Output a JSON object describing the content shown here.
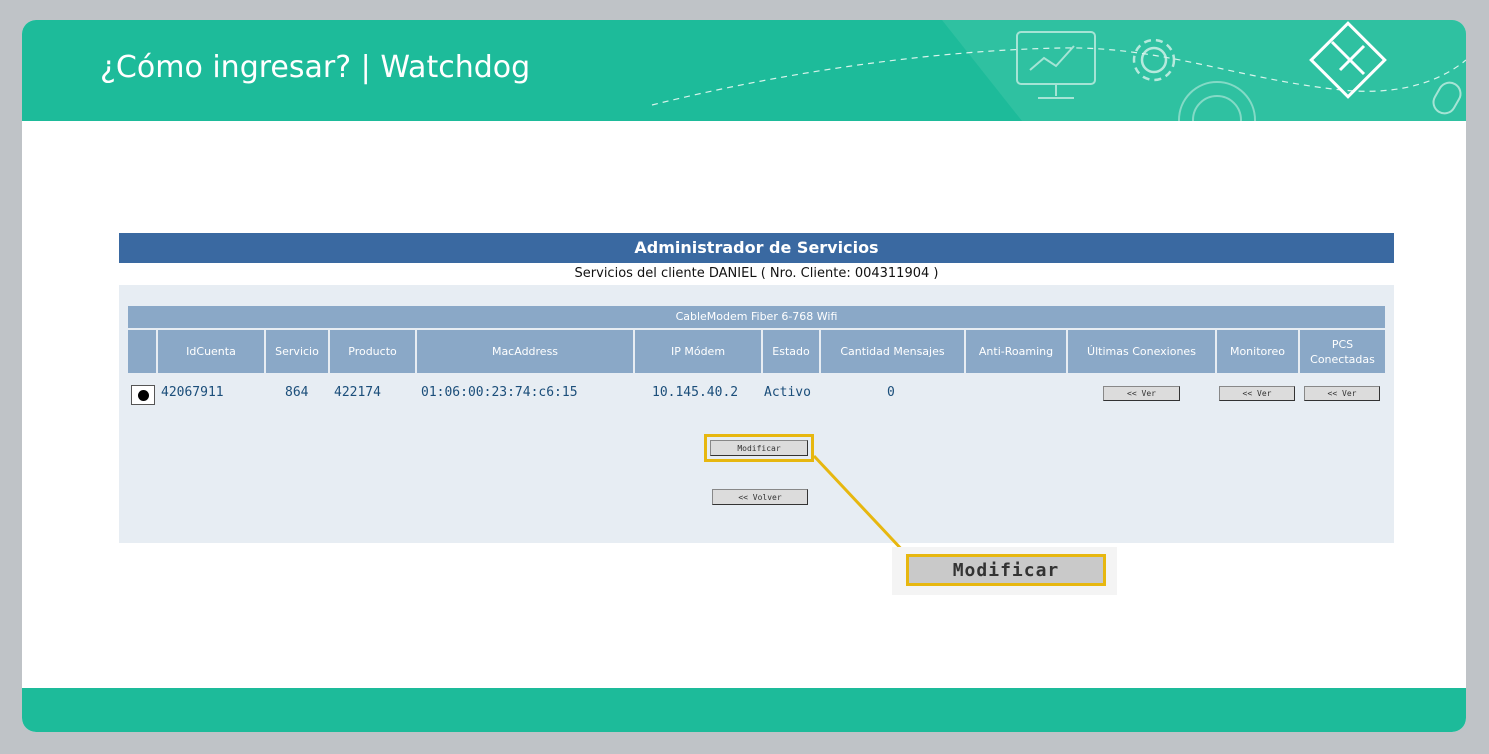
{
  "slide": {
    "title": "¿Cómo ingresar? | Watchdog"
  },
  "screen": {
    "admin_title": "Administrador de Servicios",
    "client_line": "Servicios del cliente DANIEL ( Nro. Cliente: 004311904 )",
    "product_title": "CableModem Fiber 6-768 Wifi",
    "columns": [
      "IdCuenta",
      "Servicio",
      "Producto",
      "MacAddress",
      "IP Módem",
      "Estado",
      "Cantidad Mensajes",
      "Anti-Roaming",
      "Últimas Conexiones",
      "Monitoreo",
      "PCS Conectadas"
    ],
    "row": {
      "idcuenta": "42067911",
      "servicio": "864",
      "producto": "422174",
      "mac": "01:06:00:23:74:c6:15",
      "ip": "10.145.40.2",
      "estado": "Activo",
      "mensajes": "0"
    },
    "ver_label": "<< Ver",
    "modificar_label": "Modificar",
    "volver_label": "<< Volver"
  },
  "callout": {
    "label": "Modificar"
  },
  "colors": {
    "brand": "#1dbb9a",
    "table_header": "#3a69a1",
    "highlight": "#e7b70f"
  }
}
